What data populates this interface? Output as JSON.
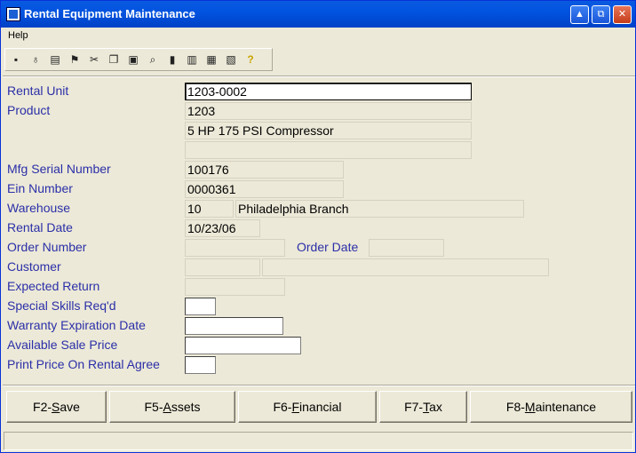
{
  "window": {
    "title": "Rental Equipment Maintenance"
  },
  "menu": {
    "help": "Help"
  },
  "toolbar": {
    "icons": [
      "save-icon",
      "basket-icon",
      "print-icon",
      "run-icon",
      "cut-icon",
      "copy-icon",
      "paste-icon",
      "find-icon",
      "exit-icon",
      "chart-icon",
      "calculator-icon",
      "calendar-icon",
      "help-icon"
    ]
  },
  "form": {
    "rental_unit": {
      "label": "Rental Unit",
      "value": "1203-0002"
    },
    "product": {
      "label": "Product",
      "value": "1203",
      "description": "5 HP 175 PSI Compressor",
      "description2": ""
    },
    "mfg_serial": {
      "label": "Mfg Serial Number",
      "value": "100176"
    },
    "ein": {
      "label": "Ein Number",
      "value": "0000361"
    },
    "warehouse": {
      "label": "Warehouse",
      "code": "10",
      "name": "Philadelphia Branch"
    },
    "rental_date": {
      "label": "Rental Date",
      "value": "10/23/06"
    },
    "order_number": {
      "label": "Order Number",
      "value": ""
    },
    "order_date": {
      "label": "Order Date",
      "value": ""
    },
    "customer": {
      "label": "Customer",
      "code": "",
      "name": ""
    },
    "expected_return": {
      "label": "Expected Return",
      "value": ""
    },
    "special_skills": {
      "label": "Special Skills Req'd",
      "value": ""
    },
    "warranty_expiration": {
      "label": "Warranty Expiration Date",
      "value": ""
    },
    "available_sale_price": {
      "label": "Available Sale Price",
      "value": ""
    },
    "print_price": {
      "label": "Print Price On Rental Agree",
      "value": ""
    }
  },
  "buttons": {
    "save": {
      "prefix": "F2-",
      "accel": "S",
      "rest": "ave"
    },
    "assets": {
      "prefix": "F5-",
      "accel": "A",
      "rest": "ssets"
    },
    "financial": {
      "prefix": "F6-",
      "accel": "F",
      "rest": "inancial"
    },
    "tax": {
      "prefix": "F7-",
      "accel": "T",
      "rest": "ax"
    },
    "maintenance": {
      "prefix": "F8-",
      "accel": "M",
      "rest": "aintenance"
    }
  }
}
